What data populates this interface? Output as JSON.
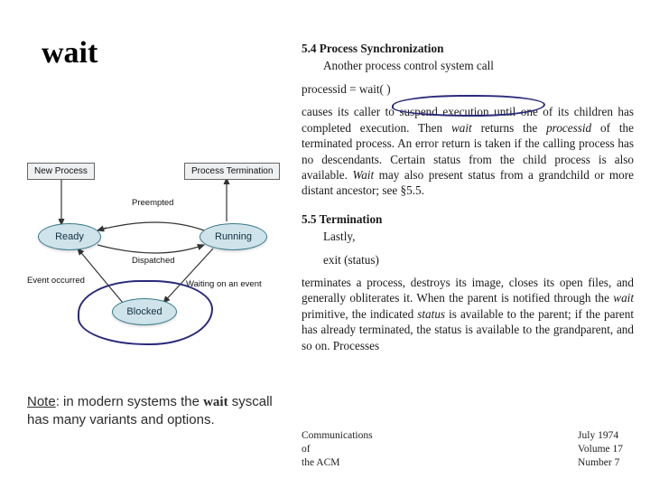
{
  "title": "wait",
  "diagram": {
    "boxes": {
      "new_process": "New Process",
      "termination": "Process Termination"
    },
    "states": {
      "ready": "Ready",
      "running": "Running",
      "blocked": "Blocked"
    },
    "labels": {
      "preempted": "Preempted",
      "dispatched": "Dispatched",
      "event_occurred": "Event occurred",
      "waiting": "Waiting on an event"
    }
  },
  "note": {
    "label": "Note",
    "colon": ": in modern systems the ",
    "wait": "wait",
    "rest": " syscall has many variants and options."
  },
  "right": {
    "sec54_head": "5.4  Process Synchronization",
    "sec54_sub": "Another process control system call",
    "wait_code": "processid = wait( )",
    "para1a": "causes its caller to suspend execution until one of its children has completed execution. Then ",
    "para1b": "wait",
    "para1c": " returns the ",
    "para1d": "processid",
    "para1e": " of the terminated process. An error return is taken if the calling process has no descendants. Certain status from the child process is also available. ",
    "para1f": "Wait",
    "para1g": " may also present status from a grandchild or more distant ancestor; see §5.5.",
    "sec55_head": "5.5  Termination",
    "sec55_sub": "Lastly,",
    "exit_code": "exit (status)",
    "para2a": "terminates a process, destroys its image, closes its open files, and generally obliterates it. When the parent is notified through the ",
    "para2b": "wait",
    "para2c": " primitive, the indicated ",
    "para2d": "status",
    "para2e": " is available to the parent; if the parent has already terminated, the status is available to the grandparent, and so on. Processes"
  },
  "footer": {
    "comm": "Communications",
    "of": "of",
    "acm": "the ACM",
    "date": "July 1974",
    "vol": "Volume 17",
    "num": "Number 7"
  }
}
